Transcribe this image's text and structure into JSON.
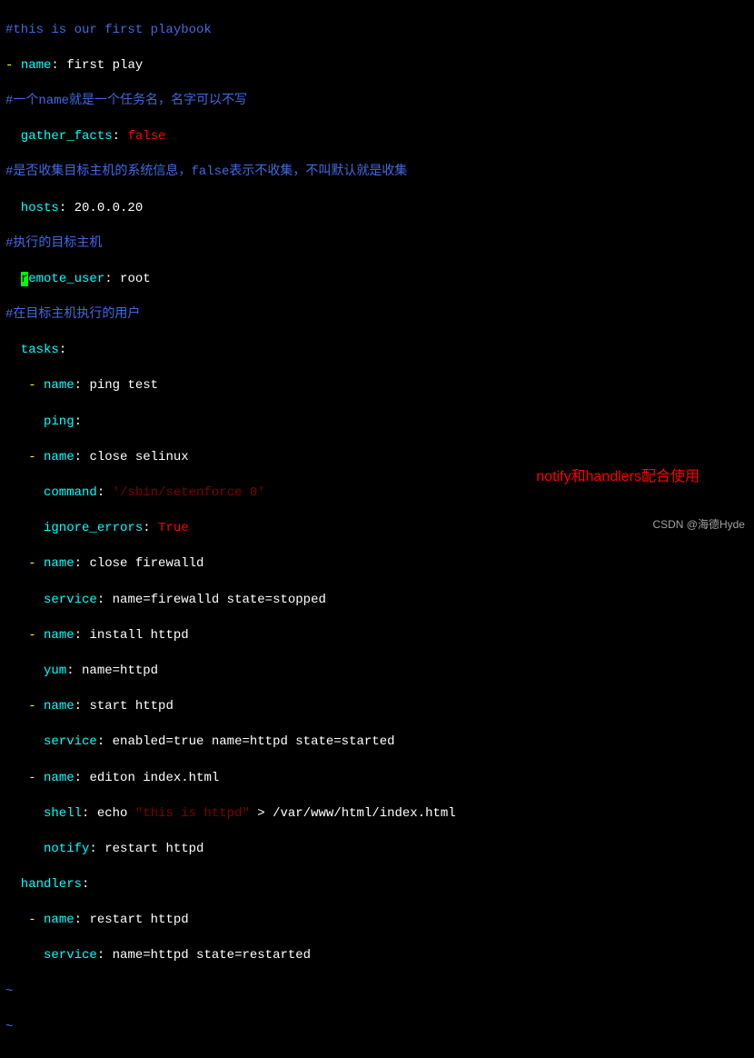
{
  "lines": {
    "l1": {
      "c1": "#this is our first playbook"
    },
    "l2": {
      "c1": "- ",
      "c2": "name",
      "c3": ": ",
      "c4": "first play"
    },
    "l3": {
      "c1": "#一个name就是一个任务名，名字可以不写"
    },
    "l4": {
      "c1": "  gather_facts",
      "c2": ": ",
      "c3": "false"
    },
    "l5": {
      "c1": "#是否收集目标主机的系统信息，false表示不收集，不叫默认就是收集"
    },
    "l6": {
      "c1": "  hosts",
      "c2": ": ",
      "c3": "20.0.0.20"
    },
    "l7": {
      "c1": "#执行的目标主机"
    },
    "l8": {
      "c0": "  ",
      "c1": "r",
      "c2": "emote_user",
      "c3": ": ",
      "c4": "root"
    },
    "l9": {
      "c1": "#在目标主机执行的用户"
    },
    "l10": {
      "c1": "  tasks",
      "c2": ":"
    },
    "l11": {
      "c1": "   - ",
      "c2": "name",
      "c3": ": ",
      "c4": "ping test"
    },
    "l12": {
      "c1": "     ping",
      "c2": ":"
    },
    "l13": {
      "c1": "   - ",
      "c2": "name",
      "c3": ": ",
      "c4": "close selinux"
    },
    "l14": {
      "c1": "     command",
      "c2": ": ",
      "c3": "'/sbin/setenforce 0'"
    },
    "l15": {
      "c1": "     ignore_errors",
      "c2": ": ",
      "c3": "True"
    },
    "l16": {
      "c1": "   - ",
      "c2": "name",
      "c3": ": ",
      "c4": "close firewalld"
    },
    "l17": {
      "c1": "     service",
      "c2": ": ",
      "c3": "name=firewalld state=stopped"
    },
    "l18": {
      "c1": "   - ",
      "c2": "name",
      "c3": ": ",
      "c4": "install httpd"
    },
    "l19": {
      "c1": "     yum",
      "c2": ": ",
      "c3": "name=httpd"
    },
    "l20": {
      "c1": "   - ",
      "c2": "name",
      "c3": ": ",
      "c4": "start httpd"
    },
    "l21": {
      "c1": "     service",
      "c2": ": ",
      "c3": "enabled=true name=httpd state=started"
    },
    "l22": {
      "c1": "   - ",
      "c2": "name",
      "c3": ": ",
      "c4": "editon index.html"
    },
    "l23": {
      "c1": "     shell",
      "c2": ": ",
      "c3": "echo ",
      "c4": "\"this is httpd\"",
      "c5": " > /var/www/html/index.html"
    },
    "l24": {
      "c1": "     notify",
      "c2": ": ",
      "c3": "restart httpd"
    },
    "l25": {
      "c1": "  handlers",
      "c2": ":"
    },
    "l26": {
      "c1": "   - ",
      "c2": "name",
      "c3": ": ",
      "c4": "restart httpd"
    },
    "l27": {
      "c1": "     service",
      "c2": ": ",
      "c3": "name=httpd state=restarted"
    },
    "tilde1": "~",
    "tilde2": "~"
  },
  "annotation": "notify和handlers配合使用",
  "watermark": "CSDN @海德Hyde"
}
